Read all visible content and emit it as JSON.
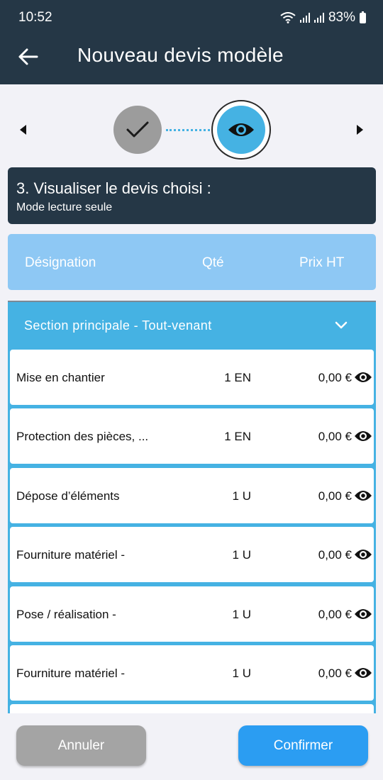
{
  "status": {
    "time": "10:52",
    "battery": "83%"
  },
  "header": {
    "title": "Nouveau devis modèle"
  },
  "stepper": {
    "step1": "done",
    "step2": "current"
  },
  "step_card": {
    "title": "3. Visualiser le devis choisi :",
    "subtitle": "Mode lecture seule"
  },
  "columns": {
    "designation": "Désignation",
    "qty": "Qté",
    "price": "Prix HT"
  },
  "section": {
    "label": "Section principale - Tout-venant"
  },
  "rows": [
    {
      "designation": "Mise en chantier",
      "qty": "1 EN",
      "price": "0,00 €"
    },
    {
      "designation": "Protection des pièces, ...",
      "qty": "1 EN",
      "price": "0,00 €"
    },
    {
      "designation": "Dépose d’éléments",
      "qty": "1 U",
      "price": "0,00 €"
    },
    {
      "designation": "Fourniture matériel -",
      "qty": "1 U",
      "price": "0,00 €"
    },
    {
      "designation": "Pose / réalisation -",
      "qty": "1 U",
      "price": "0,00 €"
    },
    {
      "designation": "Fourniture matériel -",
      "qty": "1 U",
      "price": "0,00 €"
    }
  ],
  "buttons": {
    "cancel": "Annuler",
    "confirm": "Confirmer"
  },
  "colors": {
    "header_bg": "#253746",
    "accent_blue": "#45b2e3",
    "column_header_bg": "#8ec8f4",
    "confirm_button": "#2b9df2",
    "cancel_button": "#a4a4a4"
  },
  "icons": [
    "back-arrow-icon",
    "check-icon",
    "eye-icon",
    "chevron-down-icon",
    "wifi-icon",
    "battery-icon"
  ]
}
